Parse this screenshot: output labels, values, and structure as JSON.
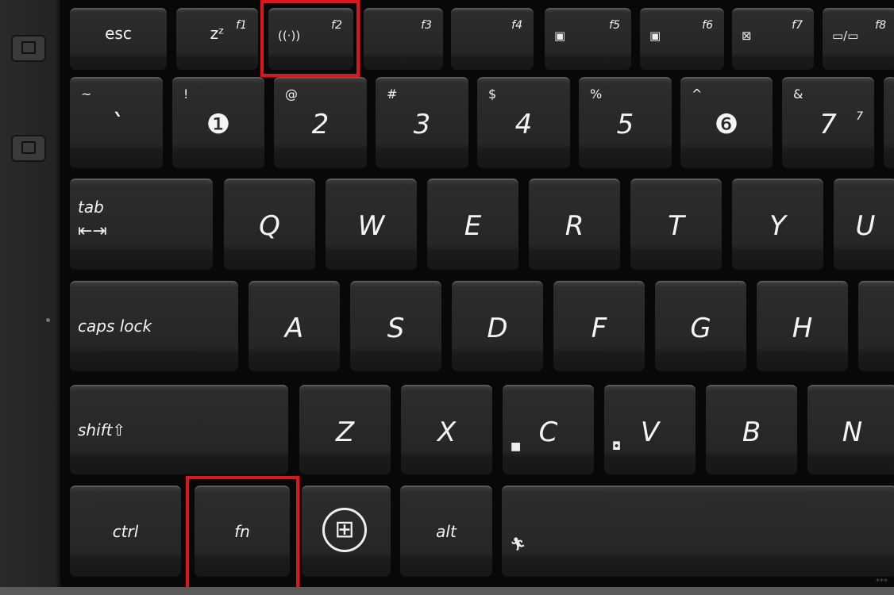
{
  "rows": [
    [
      {
        "main": "esc"
      },
      {
        "main": "zᶻ",
        "sub": "f1"
      },
      {
        "icon": "wireless-icon",
        "glyph": "((·))",
        "sub": "f2",
        "highlighted": true
      },
      {
        "sub": "f3"
      },
      {
        "sub": "f4"
      },
      {
        "icon": "brightness-down-icon",
        "glyph": "▣",
        "sub": "f5"
      },
      {
        "icon": "brightness-up-icon",
        "glyph": "▣",
        "sub": "f6"
      },
      {
        "icon": "display-off-icon",
        "glyph": "⊠",
        "sub": "f7"
      },
      {
        "icon": "display-switch-icon",
        "glyph": "▭/▭",
        "sub": "f8"
      }
    ],
    [
      {
        "main": "`",
        "sym": "~"
      },
      {
        "main": "❶",
        "sym": "!"
      },
      {
        "main": "2",
        "sym": "@"
      },
      {
        "main": "3",
        "sym": "#"
      },
      {
        "main": "4",
        "sym": "$"
      },
      {
        "main": "5",
        "sym": "%"
      },
      {
        "main": "❻",
        "sym": "^"
      },
      {
        "main": "7",
        "sym": "&",
        "sub": "7"
      },
      {
        "main": ""
      }
    ],
    [
      {
        "main": "tab",
        "icon": "tab-arrows-icon",
        "glyph": "⇤⇥"
      },
      {
        "main": "Q"
      },
      {
        "main": "W"
      },
      {
        "main": "E"
      },
      {
        "main": "R"
      },
      {
        "main": "T"
      },
      {
        "main": "Y"
      },
      {
        "main": "U"
      }
    ],
    [
      {
        "main": "caps lock"
      },
      {
        "main": "A"
      },
      {
        "main": "S"
      },
      {
        "main": "D"
      },
      {
        "main": "F"
      },
      {
        "main": "G"
      },
      {
        "main": "H"
      },
      {
        "main": ""
      }
    ],
    [
      {
        "main": "shift⇧"
      },
      {
        "main": "Z"
      },
      {
        "main": "X"
      },
      {
        "main": "C",
        "icon": "splendid-icon",
        "glyph": "■"
      },
      {
        "main": "V",
        "icon": "camera-icon",
        "glyph": "◘"
      },
      {
        "main": "B"
      },
      {
        "main": "N"
      }
    ],
    [
      {
        "main": "ctrl"
      },
      {
        "main": "fn",
        "highlighted": true
      },
      {
        "icon": "windows-logo-icon",
        "glyph": "⊞"
      },
      {
        "main": "alt"
      },
      {
        "icon": "running-man-icon",
        "glyph": "🏃︎"
      }
    ]
  ],
  "highlight_color": "#e0141b",
  "watermark": "***"
}
